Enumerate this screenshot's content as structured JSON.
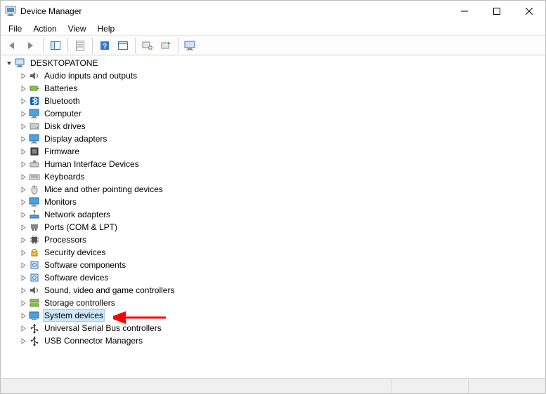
{
  "title": "Device Manager",
  "menus": {
    "file": "File",
    "action": "Action",
    "view": "View",
    "help": "Help"
  },
  "toolbar": {
    "back": "Back",
    "forward": "Forward",
    "show_hide_tree": "Show/Hide Console Tree",
    "properties": "Properties",
    "help": "Help",
    "scan": "Scan for hardware changes",
    "add_legacy": "Add legacy hardware",
    "monitor": "Devices"
  },
  "tree": {
    "root": "DESKTOPATONE",
    "items": [
      {
        "label": "Audio inputs and outputs",
        "icon": "speaker-icon"
      },
      {
        "label": "Batteries",
        "icon": "battery-icon"
      },
      {
        "label": "Bluetooth",
        "icon": "bluetooth-icon"
      },
      {
        "label": "Computer",
        "icon": "monitor-icon"
      },
      {
        "label": "Disk drives",
        "icon": "disk-icon"
      },
      {
        "label": "Display adapters",
        "icon": "monitor-icon"
      },
      {
        "label": "Firmware",
        "icon": "chip-icon"
      },
      {
        "label": "Human Interface Devices",
        "icon": "hid-icon"
      },
      {
        "label": "Keyboards",
        "icon": "keyboard-icon"
      },
      {
        "label": "Mice and other pointing devices",
        "icon": "mouse-icon"
      },
      {
        "label": "Monitors",
        "icon": "monitor-icon"
      },
      {
        "label": "Network adapters",
        "icon": "network-icon"
      },
      {
        "label": "Ports (COM & LPT)",
        "icon": "port-icon"
      },
      {
        "label": "Processors",
        "icon": "cpu-icon"
      },
      {
        "label": "Security devices",
        "icon": "security-icon"
      },
      {
        "label": "Software components",
        "icon": "software-icon"
      },
      {
        "label": "Software devices",
        "icon": "software-icon"
      },
      {
        "label": "Sound, video and game controllers",
        "icon": "speaker-icon"
      },
      {
        "label": "Storage controllers",
        "icon": "storage-icon"
      },
      {
        "label": "System devices",
        "icon": "system-icon",
        "selected": true
      },
      {
        "label": "Universal Serial Bus controllers",
        "icon": "usb-icon"
      },
      {
        "label": "USB Connector Managers",
        "icon": "usb-icon"
      }
    ]
  },
  "arrow_color": "#ff0000"
}
